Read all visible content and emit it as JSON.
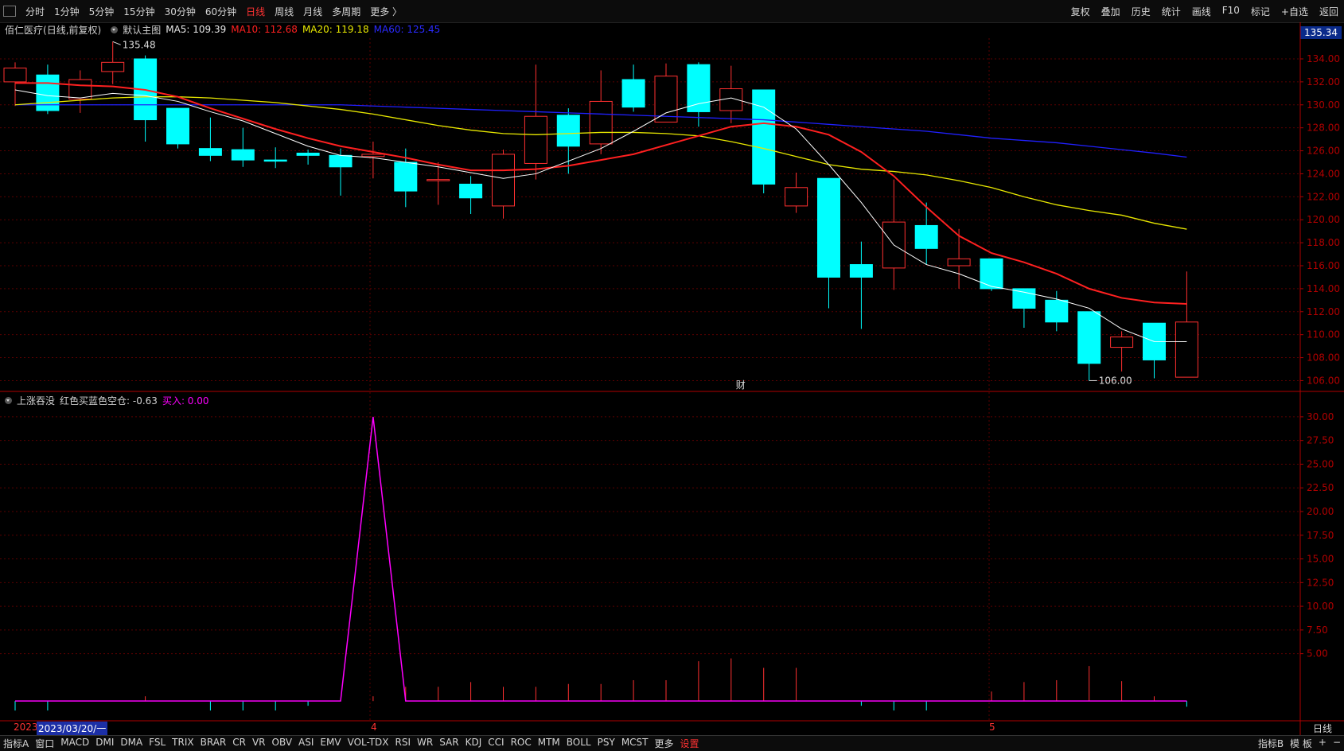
{
  "toolbar": {
    "periods": [
      "分时",
      "1分钟",
      "5分钟",
      "15分钟",
      "30分钟",
      "60分钟",
      "日线",
      "周线",
      "月线",
      "多周期",
      "更多 〉"
    ],
    "active_period": "日线",
    "right_buttons": [
      "复权",
      "叠加",
      "历史",
      "统计",
      "画线",
      "F10",
      "标记",
      "+自选",
      "返回"
    ]
  },
  "info": {
    "stock": "佰仁医疗",
    "suffix": "(日线,前复权)",
    "template": "默认主图",
    "ma5": "MA5: 109.39",
    "ma10": "MA10: 112.68",
    "ma20": "MA20: 119.18",
    "ma60": "MA60: 125.45",
    "current_price": "135.34"
  },
  "colors": {
    "up": "#ff3030",
    "down": "#00ffff",
    "ma5": "#ffffff",
    "ma10": "#ff2020",
    "ma20": "#e8e800",
    "ma60": "#2020ff",
    "indicator": "#ff00ff",
    "grid": "#5a0000",
    "axis": "#b00000"
  },
  "price_axis": [
    "134.00",
    "132.00",
    "130.00",
    "128.00",
    "126.00",
    "124.00",
    "122.00",
    "120.00",
    "118.00",
    "116.00",
    "114.00",
    "112.00",
    "110.00",
    "108.00",
    "106.00"
  ],
  "indicator_axis": [
    "30.00",
    "27.50",
    "25.00",
    "22.50",
    "20.00",
    "17.50",
    "15.00",
    "12.50",
    "10.00",
    "7.50",
    "5.00"
  ],
  "annotations": {
    "high": "135.48",
    "low": "106.00",
    "fin_marker": "财"
  },
  "indicator": {
    "name": "上涨吞没",
    "label1": "红色买蓝色空仓: -0.63",
    "label2": "买入: 0.00"
  },
  "dates": {
    "year": "2023",
    "cursor": "2023/03/20/一",
    "month4": "4",
    "month5": "5",
    "period_label": "日线"
  },
  "bottom": {
    "indicators": [
      "指标A",
      "窗口",
      "MACD",
      "DMI",
      "DMA",
      "FSL",
      "TRIX",
      "BRAR",
      "CR",
      "VR",
      "OBV",
      "ASI",
      "EMV",
      "VOL-TDX",
      "RSI",
      "WR",
      "SAR",
      "KDJ",
      "CCI",
      "ROC",
      "MTM",
      "BOLL",
      "PSY",
      "MCST",
      "更多"
    ],
    "settings": "设置",
    "right": [
      "指标B",
      "模 板",
      "+",
      "−"
    ]
  },
  "chart_data": {
    "type": "candlestick",
    "candles": [
      {
        "o": 132.0,
        "h": 133.7,
        "l": 129.9,
        "c": 133.2
      },
      {
        "o": 132.6,
        "h": 133.5,
        "l": 129.2,
        "c": 129.5
      },
      {
        "o": 130.5,
        "h": 133.0,
        "l": 129.3,
        "c": 132.2
      },
      {
        "o": 132.9,
        "h": 135.5,
        "l": 131.8,
        "c": 133.7
      },
      {
        "o": 134.0,
        "h": 134.3,
        "l": 126.8,
        "c": 128.7
      },
      {
        "o": 129.7,
        "h": 129.7,
        "l": 126.2,
        "c": 126.6
      },
      {
        "o": 126.2,
        "h": 128.9,
        "l": 125.1,
        "c": 125.6
      },
      {
        "o": 126.1,
        "h": 128.0,
        "l": 124.6,
        "c": 125.2
      },
      {
        "o": 125.2,
        "h": 126.3,
        "l": 124.5,
        "c": 125.1
      },
      {
        "o": 125.8,
        "h": 126.1,
        "l": 124.8,
        "c": 125.6
      },
      {
        "o": 125.6,
        "h": 126.2,
        "l": 122.1,
        "c": 124.6
      },
      {
        "o": 125.5,
        "h": 126.8,
        "l": 123.6,
        "c": 125.7
      },
      {
        "o": 125.0,
        "h": 126.2,
        "l": 121.1,
        "c": 122.5
      },
      {
        "o": 123.5,
        "h": 125.0,
        "l": 121.3,
        "c": 123.5
      },
      {
        "o": 123.1,
        "h": 123.8,
        "l": 120.5,
        "c": 121.9
      },
      {
        "o": 121.2,
        "h": 126.1,
        "l": 120.1,
        "c": 125.7
      },
      {
        "o": 124.9,
        "h": 133.5,
        "l": 123.5,
        "c": 129.0
      },
      {
        "o": 129.1,
        "h": 129.7,
        "l": 124.0,
        "c": 126.4
      },
      {
        "o": 126.6,
        "h": 133.0,
        "l": 125.7,
        "c": 130.3
      },
      {
        "o": 132.2,
        "h": 133.5,
        "l": 129.4,
        "c": 129.8
      },
      {
        "o": 128.5,
        "h": 133.6,
        "l": 128.5,
        "c": 132.5
      },
      {
        "o": 133.5,
        "h": 133.7,
        "l": 128.1,
        "c": 129.4
      },
      {
        "o": 129.5,
        "h": 133.4,
        "l": 128.4,
        "c": 131.4
      },
      {
        "o": 131.3,
        "h": 131.3,
        "l": 122.3,
        "c": 123.1
      },
      {
        "o": 121.2,
        "h": 124.1,
        "l": 120.6,
        "c": 122.8
      },
      {
        "o": 123.6,
        "h": 123.6,
        "l": 112.3,
        "c": 115.0
      },
      {
        "o": 116.1,
        "h": 118.1,
        "l": 110.5,
        "c": 115.0
      },
      {
        "o": 115.8,
        "h": 123.5,
        "l": 113.9,
        "c": 119.8
      },
      {
        "o": 119.5,
        "h": 121.5,
        "l": 116.1,
        "c": 117.5
      },
      {
        "o": 116.0,
        "h": 119.2,
        "l": 114.0,
        "c": 116.6
      },
      {
        "o": 116.6,
        "h": 116.6,
        "l": 113.8,
        "c": 114.0
      },
      {
        "o": 114.0,
        "h": 114.0,
        "l": 110.6,
        "c": 112.3
      },
      {
        "o": 113.0,
        "h": 113.8,
        "l": 110.3,
        "c": 111.1
      },
      {
        "o": 112.0,
        "h": 112.0,
        "l": 106.0,
        "c": 107.5
      },
      {
        "o": 108.9,
        "h": 110.3,
        "l": 106.8,
        "c": 109.8
      },
      {
        "o": 111.0,
        "h": 111.0,
        "l": 106.2,
        "c": 107.8
      },
      {
        "o": 106.3,
        "h": 115.5,
        "l": 106.3,
        "c": 111.1
      }
    ],
    "ma5": [
      131.3,
      130.8,
      130.6,
      131.0,
      130.8,
      130.3,
      129.4,
      128.6,
      127.5,
      126.4,
      125.6,
      125.4,
      125.0,
      124.6,
      124.1,
      123.6,
      124.0,
      125.1,
      126.2,
      127.7,
      129.3,
      130.1,
      130.6,
      129.8,
      127.9,
      124.8,
      121.5,
      117.8,
      116.1,
      115.3,
      114.2,
      113.7,
      113.1,
      112.3,
      110.5,
      109.4,
      109.39
    ],
    "ma10": [
      131.9,
      131.9,
      131.7,
      131.6,
      131.3,
      130.7,
      129.7,
      128.8,
      127.9,
      127.1,
      126.4,
      125.9,
      125.4,
      124.8,
      124.3,
      124.3,
      124.4,
      124.7,
      125.2,
      125.7,
      126.5,
      127.3,
      128.1,
      128.4,
      128.1,
      127.4,
      125.9,
      123.8,
      121.1,
      118.6,
      117.1,
      116.3,
      115.3,
      114.0,
      113.2,
      112.8,
      112.68
    ],
    "ma20": [
      130.0,
      130.2,
      130.4,
      130.6,
      130.7,
      130.7,
      130.6,
      130.4,
      130.2,
      129.9,
      129.6,
      129.2,
      128.7,
      128.2,
      127.8,
      127.5,
      127.4,
      127.5,
      127.6,
      127.6,
      127.5,
      127.3,
      126.8,
      126.2,
      125.5,
      124.8,
      124.4,
      124.2,
      123.9,
      123.4,
      122.8,
      122.0,
      121.3,
      120.8,
      120.4,
      119.7,
      119.18
    ],
    "ma60": [
      130.0,
      130.0,
      130.0,
      130.0,
      130.0,
      130.0,
      130.0,
      130.0,
      130.0,
      130.0,
      130.0,
      129.9,
      129.8,
      129.7,
      129.6,
      129.5,
      129.4,
      129.3,
      129.2,
      129.1,
      129.0,
      128.9,
      128.8,
      128.7,
      128.5,
      128.3,
      128.1,
      127.9,
      127.7,
      127.4,
      127.1,
      126.9,
      126.7,
      126.4,
      126.1,
      125.8,
      125.45
    ],
    "indicator_line": [
      0,
      0,
      0,
      0,
      0,
      0,
      0,
      0,
      0,
      0,
      0,
      30,
      0,
      0,
      0,
      0,
      0,
      0,
      0,
      0,
      0,
      0,
      0,
      0,
      0,
      0,
      0,
      0,
      0,
      0,
      0,
      0,
      0,
      0,
      0,
      0,
      0
    ],
    "volume_marks": [
      -1,
      -1,
      0,
      0,
      0.5,
      0,
      -1,
      -1,
      -1,
      -0.5,
      0,
      0.5,
      1.5,
      1.5,
      2,
      1.5,
      1.5,
      1.8,
      1.8,
      2.2,
      2.2,
      4.2,
      4.5,
      3.5,
      3.5,
      0,
      -0.5,
      -1,
      -1,
      0,
      1,
      2,
      2.2,
      3.7,
      2.1,
      0.5,
      -0.6
    ],
    "price_ylim": [
      105.2,
      135.8
    ],
    "indicator_ylim": [
      -2,
      31
    ],
    "grid": true
  }
}
